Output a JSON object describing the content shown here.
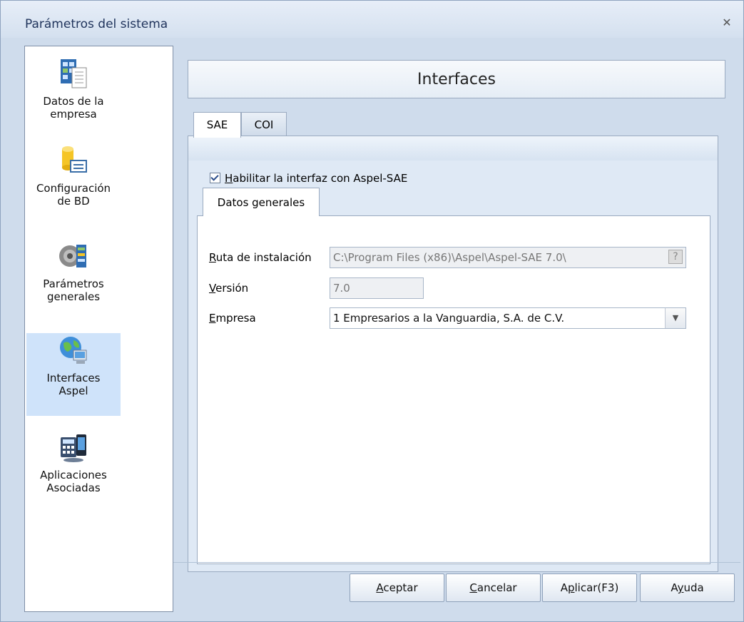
{
  "window": {
    "title": "Parámetros del sistema",
    "close_icon": "close-icon"
  },
  "sidebar": {
    "items": [
      {
        "label_line1": "Datos de la",
        "label_line2": "empresa",
        "icon": "company-data-icon",
        "selected": false
      },
      {
        "label_line1": "Configuración",
        "label_line2": "de BD",
        "icon": "database-config-icon",
        "selected": false
      },
      {
        "label_line1": "Parámetros",
        "label_line2": "generales",
        "icon": "general-params-icon",
        "selected": false
      },
      {
        "label_line1": "Interfaces",
        "label_line2": "Aspel",
        "icon": "globe-computer-icon",
        "selected": true
      },
      {
        "label_line1": "Aplicaciones",
        "label_line2": "Asociadas",
        "icon": "calculator-phone-icon",
        "selected": false
      }
    ]
  },
  "header": {
    "title": "Interfaces"
  },
  "tabs": [
    {
      "label": "SAE",
      "active": true
    },
    {
      "label": "COI",
      "active": false
    }
  ],
  "panel": {
    "checkbox": {
      "label": "Habilitar la interfaz con Aspel-SAE",
      "accel": "H",
      "checked": true
    },
    "subtab": {
      "label": "Datos generales"
    },
    "fields": {
      "ruta": {
        "label": "Ruta de instalación",
        "accel": "R",
        "value": "C:\\Program Files (x86)\\Aspel\\Aspel-SAE 7.0\\",
        "button": "?"
      },
      "version": {
        "label": "Versión",
        "accel": "V",
        "value": "7.0"
      },
      "empresa": {
        "label": "Empresa",
        "accel": "E",
        "value": "1 Empresarios a la Vanguardia, S.A. de C.V."
      }
    }
  },
  "buttons": {
    "aceptar": "Aceptar",
    "cancelar": "Cancelar",
    "aplicar": "Aplicar(F3)",
    "ayuda": "Ayuda"
  },
  "colors": {
    "selected_bg": "#cfe3fa",
    "window_bg": "#cfdcec",
    "accent": "#20345c"
  }
}
